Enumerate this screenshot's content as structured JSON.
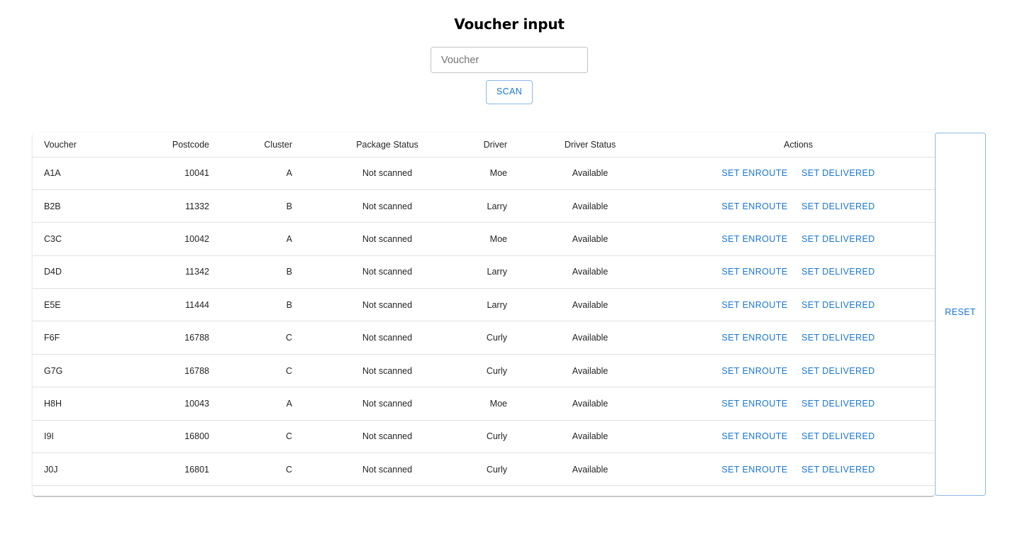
{
  "header": {
    "title": "Voucher input"
  },
  "voucher_input": {
    "placeholder": "Voucher",
    "value": ""
  },
  "scan_button": {
    "label": "SCAN"
  },
  "reset_button": {
    "label": "RESET"
  },
  "table": {
    "columns": [
      "Voucher",
      "Postcode",
      "Cluster",
      "Package Status",
      "Driver",
      "Driver Status",
      "Actions"
    ],
    "action_labels": {
      "enroute": "SET ENROUTE",
      "delivered": "SET DELIVERED"
    },
    "rows": [
      {
        "voucher": "A1A",
        "postcode": "10041",
        "cluster": "A",
        "package_status": "Not scanned",
        "driver": "Moe",
        "driver_status": "Available"
      },
      {
        "voucher": "B2B",
        "postcode": "11332",
        "cluster": "B",
        "package_status": "Not scanned",
        "driver": "Larry",
        "driver_status": "Available"
      },
      {
        "voucher": "C3C",
        "postcode": "10042",
        "cluster": "A",
        "package_status": "Not scanned",
        "driver": "Moe",
        "driver_status": "Available"
      },
      {
        "voucher": "D4D",
        "postcode": "11342",
        "cluster": "B",
        "package_status": "Not scanned",
        "driver": "Larry",
        "driver_status": "Available"
      },
      {
        "voucher": "E5E",
        "postcode": "11444",
        "cluster": "B",
        "package_status": "Not scanned",
        "driver": "Larry",
        "driver_status": "Available"
      },
      {
        "voucher": "F6F",
        "postcode": "16788",
        "cluster": "C",
        "package_status": "Not scanned",
        "driver": "Curly",
        "driver_status": "Available"
      },
      {
        "voucher": "G7G",
        "postcode": "16788",
        "cluster": "C",
        "package_status": "Not scanned",
        "driver": "Curly",
        "driver_status": "Available"
      },
      {
        "voucher": "H8H",
        "postcode": "10043",
        "cluster": "A",
        "package_status": "Not scanned",
        "driver": "Moe",
        "driver_status": "Available"
      },
      {
        "voucher": "I9I",
        "postcode": "16800",
        "cluster": "C",
        "package_status": "Not scanned",
        "driver": "Curly",
        "driver_status": "Available"
      },
      {
        "voucher": "J0J",
        "postcode": "16801",
        "cluster": "C",
        "package_status": "Not scanned",
        "driver": "Curly",
        "driver_status": "Available"
      }
    ]
  },
  "colors": {
    "accent": "#1976d2",
    "divider": "#e0e0e0",
    "input_border": "#c4c4c4"
  }
}
